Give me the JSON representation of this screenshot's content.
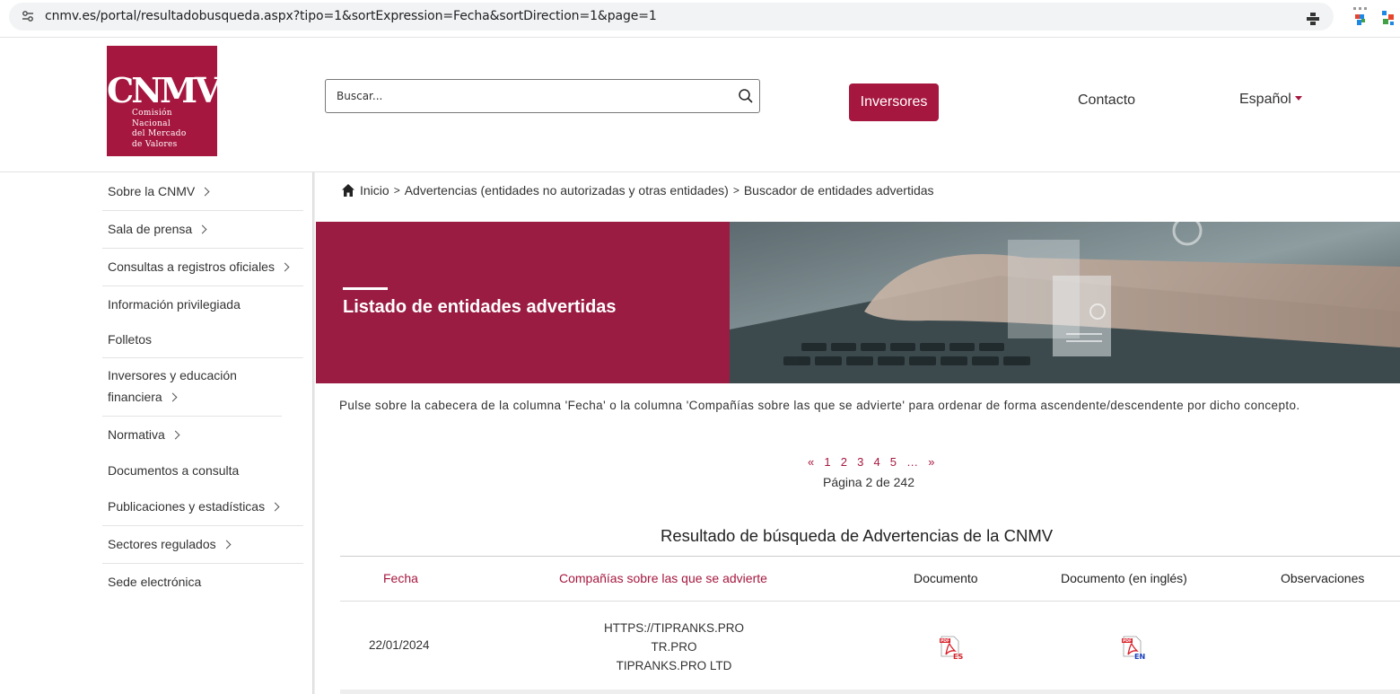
{
  "browser": {
    "url": "cnmv.es/portal/resultadobusqueda.aspx?tipo=1&sortExpression=Fecha&sortDirection=1&page=1"
  },
  "logo": {
    "acronym": "CNMV",
    "line1": "Comisión",
    "line2": "Nacional",
    "line3": "del Mercado",
    "line4": "de Valores"
  },
  "header": {
    "search_placeholder": "Buscar...",
    "investors_button": "Inversores",
    "contact_link": "Contacto",
    "language": "Español"
  },
  "sidebar": {
    "items": [
      {
        "label": "Sobre la CNMV",
        "has_submenu": true
      },
      {
        "label": "Sala de prensa",
        "has_submenu": true
      },
      {
        "label": "Consultas a registros oficiales",
        "has_submenu": true
      },
      {
        "label": "Información privilegiada",
        "has_submenu": false
      },
      {
        "label": "Folletos",
        "has_submenu": false
      },
      {
        "label": "Inversores y educación financiera",
        "has_submenu": true
      },
      {
        "label": "Normativa",
        "has_submenu": true
      },
      {
        "label": "Documentos a consulta",
        "has_submenu": false
      },
      {
        "label": "Publicaciones y estadísticas",
        "has_submenu": true
      },
      {
        "label": "Sectores regulados",
        "has_submenu": true
      },
      {
        "label": "Sede electrónica",
        "has_submenu": false
      }
    ]
  },
  "breadcrumb": {
    "home": "Inicio",
    "level1": "Advertencias (entidades no autorizadas y otras entidades)",
    "level2": "Buscador de entidades advertidas",
    "separator": ">"
  },
  "banner": {
    "title": "Listado de entidades advertidas"
  },
  "intro_text": "Pulse sobre la cabecera de la columna 'Fecha' o la columna 'Compañías sobre las que se advierte' para ordenar de forma ascendente/descendente por dicho concepto.",
  "pagination": {
    "first": "«",
    "pages": [
      "1",
      "2",
      "3",
      "4",
      "5"
    ],
    "ellipsis": "…",
    "last": "»",
    "info": "Página 2 de 242"
  },
  "results": {
    "title": "Resultado de búsqueda de Advertencias de la CNMV",
    "columns": {
      "fecha": "Fecha",
      "companias": "Compañías sobre las que se advierte",
      "documento": "Documento",
      "documento_en": "Documento (en inglés)",
      "observaciones": "Observaciones"
    },
    "rows": [
      {
        "fecha": "22/01/2024",
        "companias": [
          "HTTPS://TIPRANKS.PRO",
          "TR.PRO",
          "TIPRANKS.PRO LTD"
        ],
        "documento_icon": "pdf-es-icon",
        "documento_en_icon": "pdf-en-icon",
        "observaciones": ""
      }
    ]
  },
  "colors": {
    "brand": "#a6173f",
    "banner_left": "#9a1c43"
  }
}
